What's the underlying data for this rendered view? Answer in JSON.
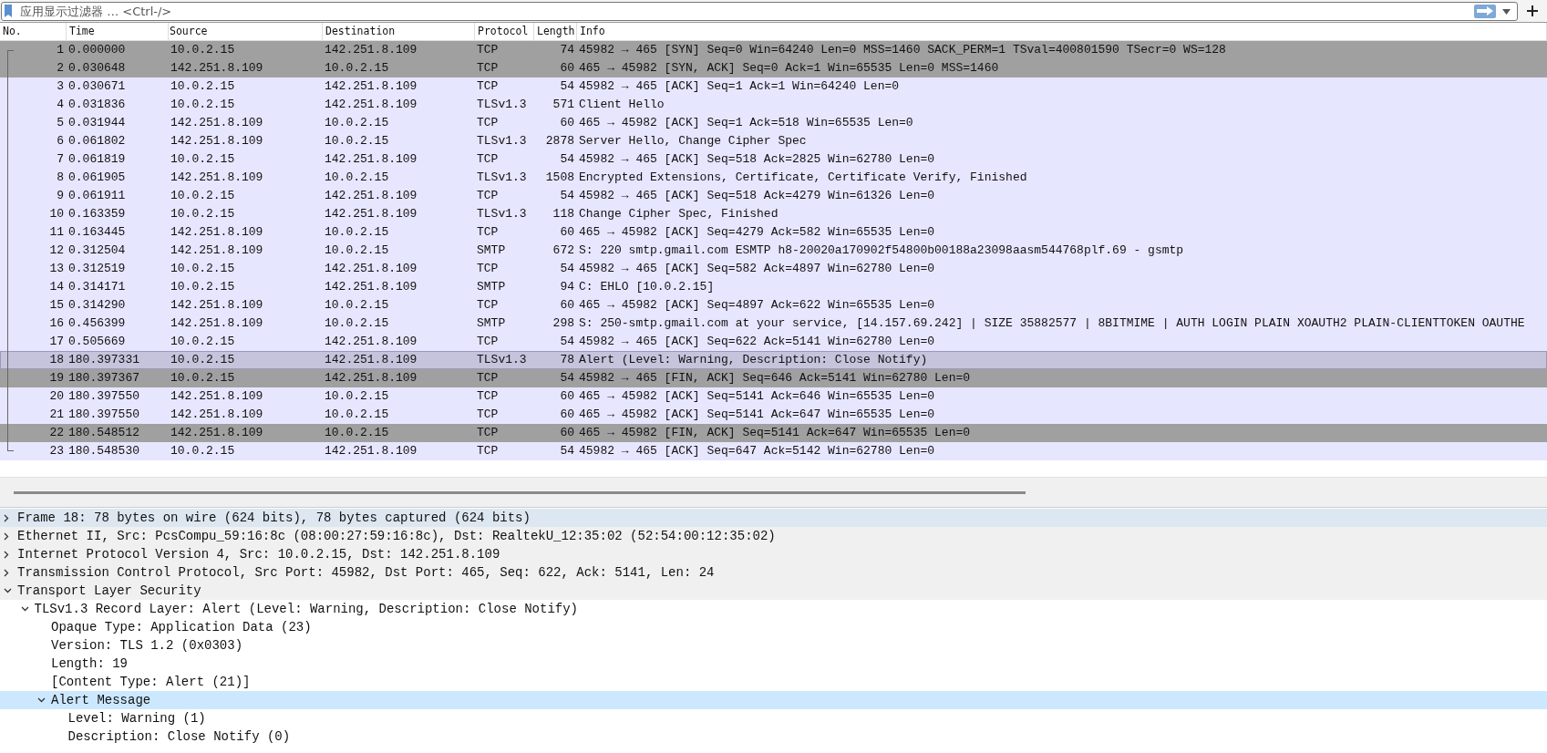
{
  "filter_bar": {
    "placeholder": "应用显示过滤器 … <Ctrl-/>"
  },
  "columns": [
    "No.",
    "Time",
    "Source",
    "Destination",
    "Protocol",
    "Length",
    "Info"
  ],
  "packets": [
    {
      "no": "1",
      "time": "0.000000",
      "source": "10.0.2.15",
      "destination": "142.251.8.109",
      "protocol": "TCP",
      "length": "74",
      "info": "45982 → 465 [SYN] Seq=0 Win=64240 Len=0 MSS=1460 SACK_PERM=1 TSval=400801590 TSecr=0 WS=128",
      "color": "#a0a0a0",
      "selected": false
    },
    {
      "no": "2",
      "time": "0.030648",
      "source": "142.251.8.109",
      "destination": "10.0.2.15",
      "protocol": "TCP",
      "length": "60",
      "info": "465 → 45982 [SYN, ACK] Seq=0 Ack=1 Win=65535 Len=0 MSS=1460",
      "color": "#a0a0a0",
      "selected": false
    },
    {
      "no": "3",
      "time": "0.030671",
      "source": "10.0.2.15",
      "destination": "142.251.8.109",
      "protocol": "TCP",
      "length": "54",
      "info": "45982 → 465 [ACK] Seq=1 Ack=1 Win=64240 Len=0",
      "color": "#e7e6ff",
      "selected": false
    },
    {
      "no": "4",
      "time": "0.031836",
      "source": "10.0.2.15",
      "destination": "142.251.8.109",
      "protocol": "TLSv1.3",
      "length": "571",
      "info": "Client Hello",
      "color": "#e7e6ff",
      "selected": false
    },
    {
      "no": "5",
      "time": "0.031944",
      "source": "142.251.8.109",
      "destination": "10.0.2.15",
      "protocol": "TCP",
      "length": "60",
      "info": "465 → 45982 [ACK] Seq=1 Ack=518 Win=65535 Len=0",
      "color": "#e7e6ff",
      "selected": false
    },
    {
      "no": "6",
      "time": "0.061802",
      "source": "142.251.8.109",
      "destination": "10.0.2.15",
      "protocol": "TLSv1.3",
      "length": "2878",
      "info": "Server Hello, Change Cipher Spec",
      "color": "#e7e6ff",
      "selected": false
    },
    {
      "no": "7",
      "time": "0.061819",
      "source": "10.0.2.15",
      "destination": "142.251.8.109",
      "protocol": "TCP",
      "length": "54",
      "info": "45982 → 465 [ACK] Seq=518 Ack=2825 Win=62780 Len=0",
      "color": "#e7e6ff",
      "selected": false
    },
    {
      "no": "8",
      "time": "0.061905",
      "source": "142.251.8.109",
      "destination": "10.0.2.15",
      "protocol": "TLSv1.3",
      "length": "1508",
      "info": "Encrypted Extensions, Certificate, Certificate Verify, Finished",
      "color": "#e7e6ff",
      "selected": false
    },
    {
      "no": "9",
      "time": "0.061911",
      "source": "10.0.2.15",
      "destination": "142.251.8.109",
      "protocol": "TCP",
      "length": "54",
      "info": "45982 → 465 [ACK] Seq=518 Ack=4279 Win=61326 Len=0",
      "color": "#e7e6ff",
      "selected": false
    },
    {
      "no": "10",
      "time": "0.163359",
      "source": "10.0.2.15",
      "destination": "142.251.8.109",
      "protocol": "TLSv1.3",
      "length": "118",
      "info": "Change Cipher Spec, Finished",
      "color": "#e7e6ff",
      "selected": false
    },
    {
      "no": "11",
      "time": "0.163445",
      "source": "142.251.8.109",
      "destination": "10.0.2.15",
      "protocol": "TCP",
      "length": "60",
      "info": "465 → 45982 [ACK] Seq=4279 Ack=582 Win=65535 Len=0",
      "color": "#e7e6ff",
      "selected": false
    },
    {
      "no": "12",
      "time": "0.312504",
      "source": "142.251.8.109",
      "destination": "10.0.2.15",
      "protocol": "SMTP",
      "length": "672",
      "info": "S: 220 smtp.gmail.com ESMTP h8-20020a170902f54800b00188a23098aasm544768plf.69 - gsmtp",
      "color": "#e7e6ff",
      "selected": false
    },
    {
      "no": "13",
      "time": "0.312519",
      "source": "10.0.2.15",
      "destination": "142.251.8.109",
      "protocol": "TCP",
      "length": "54",
      "info": "45982 → 465 [ACK] Seq=582 Ack=4897 Win=62780 Len=0",
      "color": "#e7e6ff",
      "selected": false
    },
    {
      "no": "14",
      "time": "0.314171",
      "source": "10.0.2.15",
      "destination": "142.251.8.109",
      "protocol": "SMTP",
      "length": "94",
      "info": "C: EHLO [10.0.2.15]",
      "color": "#e7e6ff",
      "selected": false
    },
    {
      "no": "15",
      "time": "0.314290",
      "source": "142.251.8.109",
      "destination": "10.0.2.15",
      "protocol": "TCP",
      "length": "60",
      "info": "465 → 45982 [ACK] Seq=4897 Ack=622 Win=65535 Len=0",
      "color": "#e7e6ff",
      "selected": false
    },
    {
      "no": "16",
      "time": "0.456399",
      "source": "142.251.8.109",
      "destination": "10.0.2.15",
      "protocol": "SMTP",
      "length": "298",
      "info": "S: 250-smtp.gmail.com at your service, [14.157.69.242] | SIZE 35882577 | 8BITMIME | AUTH LOGIN PLAIN XOAUTH2 PLAIN-CLIENTTOKEN OAUTHE",
      "color": "#e7e6ff",
      "selected": false
    },
    {
      "no": "17",
      "time": "0.505669",
      "source": "10.0.2.15",
      "destination": "142.251.8.109",
      "protocol": "TCP",
      "length": "54",
      "info": "45982 → 465 [ACK] Seq=622 Ack=5141 Win=62780 Len=0",
      "color": "#e7e6ff",
      "selected": false
    },
    {
      "no": "18",
      "time": "180.397331",
      "source": "10.0.2.15",
      "destination": "142.251.8.109",
      "protocol": "TLSv1.3",
      "length": "78",
      "info": "Alert (Level: Warning, Description: Close Notify)",
      "color": "#c6c4dc",
      "selected": true
    },
    {
      "no": "19",
      "time": "180.397367",
      "source": "10.0.2.15",
      "destination": "142.251.8.109",
      "protocol": "TCP",
      "length": "54",
      "info": "45982 → 465 [FIN, ACK] Seq=646 Ack=5141 Win=62780 Len=0",
      "color": "#a0a0a0",
      "selected": false
    },
    {
      "no": "20",
      "time": "180.397550",
      "source": "142.251.8.109",
      "destination": "10.0.2.15",
      "protocol": "TCP",
      "length": "60",
      "info": "465 → 45982 [ACK] Seq=5141 Ack=646 Win=65535 Len=0",
      "color": "#e7e6ff",
      "selected": false
    },
    {
      "no": "21",
      "time": "180.397550",
      "source": "142.251.8.109",
      "destination": "10.0.2.15",
      "protocol": "TCP",
      "length": "60",
      "info": "465 → 45982 [ACK] Seq=5141 Ack=647 Win=65535 Len=0",
      "color": "#e7e6ff",
      "selected": false
    },
    {
      "no": "22",
      "time": "180.548512",
      "source": "142.251.8.109",
      "destination": "10.0.2.15",
      "protocol": "TCP",
      "length": "60",
      "info": "465 → 45982 [FIN, ACK] Seq=5141 Ack=647 Win=65535 Len=0",
      "color": "#a0a0a0",
      "selected": false
    },
    {
      "no": "23",
      "time": "180.548530",
      "source": "10.0.2.15",
      "destination": "142.251.8.109",
      "protocol": "TCP",
      "length": "54",
      "info": "45982 → 465 [ACK] Seq=647 Ack=5142 Win=62780 Len=0",
      "color": "#e7e6ff",
      "selected": false
    }
  ],
  "details": [
    {
      "text": "Frame 18: 78 bytes on wire (624 bits), 78 bytes captured (624 bits)",
      "expanded": false,
      "hovered": true,
      "selected": false
    },
    {
      "text": "Ethernet II, Src: PcsCompu_59:16:8c (08:00:27:59:16:8c), Dst: RealtekU_12:35:02 (52:54:00:12:35:02)",
      "expanded": false,
      "hovered": false,
      "selected": false
    },
    {
      "text": "Internet Protocol Version 4, Src: 10.0.2.15, Dst: 142.251.8.109",
      "expanded": false,
      "hovered": false,
      "selected": false
    },
    {
      "text": "Transmission Control Protocol, Src Port: 45982, Dst Port: 465, Seq: 622, Ack: 5141, Len: 24",
      "expanded": false,
      "hovered": false,
      "selected": false
    },
    {
      "text": "Transport Layer Security",
      "expanded": true,
      "hovered": false,
      "selected": false,
      "children": [
        {
          "text": "TLSv1.3 Record Layer: Alert (Level: Warning, Description: Close Notify)",
          "expanded": true,
          "hovered": false,
          "selected": false,
          "children": [
            {
              "text": "Opaque Type: Application Data (23)",
              "hovered": false,
              "selected": false
            },
            {
              "text": "Version: TLS 1.2 (0x0303)",
              "hovered": false,
              "selected": false
            },
            {
              "text": "Length: 19",
              "hovered": false,
              "selected": false
            },
            {
              "text": "[Content Type: Alert (21)]",
              "hovered": false,
              "selected": false
            },
            {
              "text": "Alert Message",
              "expanded": true,
              "hovered": false,
              "selected": true,
              "children": [
                {
                  "text": "Level: Warning (1)",
                  "hovered": false,
                  "selected": false
                },
                {
                  "text": "Description: Close Notify (0)",
                  "hovered": false,
                  "selected": false
                }
              ]
            }
          ]
        }
      ]
    }
  ]
}
